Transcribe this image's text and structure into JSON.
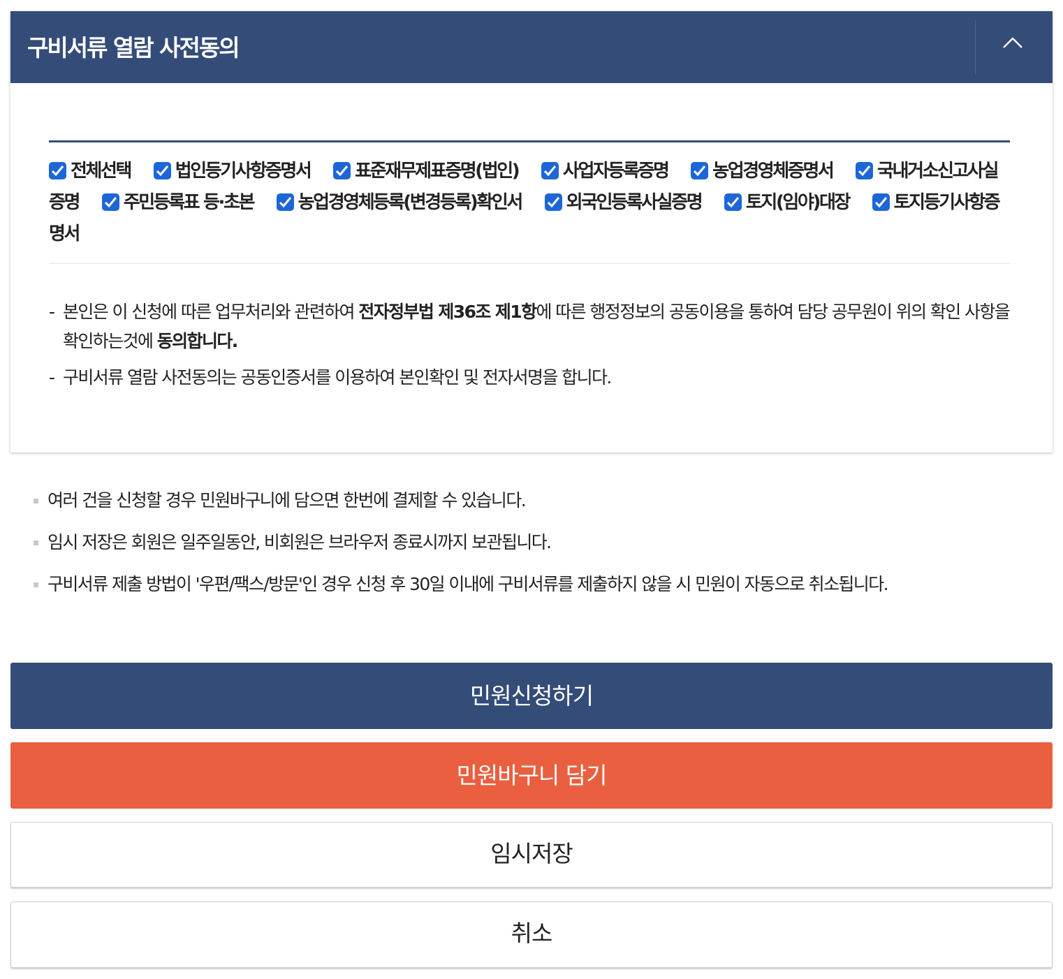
{
  "panel": {
    "title": "구비서류 열람 사전동의",
    "collapse_icon": "chevron-up-icon"
  },
  "colors": {
    "header": "#344c78",
    "checkbox": "#1e66d8",
    "basket": "#e95f3f"
  },
  "documents": [
    {
      "label": "전체선택",
      "checked": true
    },
    {
      "label": "법인등기사항증명서",
      "checked": true
    },
    {
      "label": "표준재무제표증명(법인)",
      "checked": true
    },
    {
      "label": "사업자등록증명",
      "checked": true
    },
    {
      "label": "농업경영체증명서",
      "checked": true
    },
    {
      "label": "국내거소신고사실증명",
      "checked": true
    },
    {
      "label": "주민등록표 등·초본",
      "checked": true
    },
    {
      "label": "농업경영체등록(변경등록)확인서",
      "checked": true
    },
    {
      "label": "외국인등록사실증명",
      "checked": true
    },
    {
      "label": "토지(임야)대장",
      "checked": true
    },
    {
      "label": "토지등기사항증명서",
      "checked": true
    }
  ],
  "consent": {
    "note1_pre": "본인은 이 신청에 따른 업무처리와 관련하여 ",
    "note1_bold1": "전자정부법 제36조 제1항",
    "note1_mid": "에 따른 행정정보의 공동이용을 통하여 담당 공무원이 위의 확인 사항을 확인하는것에 ",
    "note1_bold2": "동의합니다.",
    "note2": "구비서류 열람 사전동의는 공동인증서를 이용하여 본인확인 및 전자서명을 합니다."
  },
  "info": [
    "여러 건을 신청할 경우 민원바구니에 담으면 한번에 결제할 수 있습니다.",
    "임시 저장은 회원은 일주일동안, 비회원은 브라우저 종료시까지 보관됩니다.",
    "구비서류 제출 방법이 '우편/팩스/방문'인 경우 신청 후 30일 이내에 구비서류를 제출하지 않을 시 민원이 자동으로 취소됩니다."
  ],
  "buttons": {
    "apply": "민원신청하기",
    "basket": "민원바구니 담기",
    "save": "임시저장",
    "cancel": "취소"
  }
}
